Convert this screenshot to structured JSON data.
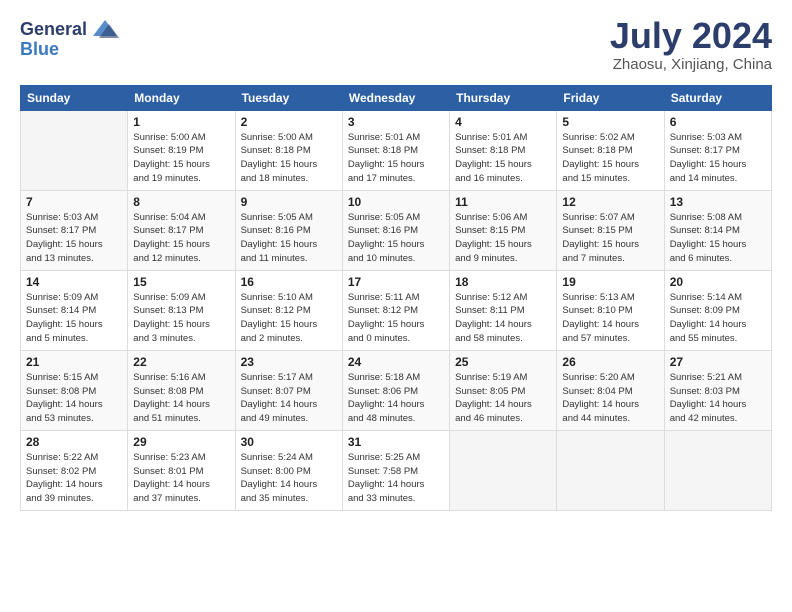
{
  "header": {
    "logo_general": "General",
    "logo_blue": "Blue",
    "month_title": "July 2024",
    "subtitle": "Zhaosu, Xinjiang, China"
  },
  "days_of_week": [
    "Sunday",
    "Monday",
    "Tuesday",
    "Wednesday",
    "Thursday",
    "Friday",
    "Saturday"
  ],
  "weeks": [
    [
      {
        "day": "",
        "info": ""
      },
      {
        "day": "1",
        "info": "Sunrise: 5:00 AM\nSunset: 8:19 PM\nDaylight: 15 hours\nand 19 minutes."
      },
      {
        "day": "2",
        "info": "Sunrise: 5:00 AM\nSunset: 8:18 PM\nDaylight: 15 hours\nand 18 minutes."
      },
      {
        "day": "3",
        "info": "Sunrise: 5:01 AM\nSunset: 8:18 PM\nDaylight: 15 hours\nand 17 minutes."
      },
      {
        "day": "4",
        "info": "Sunrise: 5:01 AM\nSunset: 8:18 PM\nDaylight: 15 hours\nand 16 minutes."
      },
      {
        "day": "5",
        "info": "Sunrise: 5:02 AM\nSunset: 8:18 PM\nDaylight: 15 hours\nand 15 minutes."
      },
      {
        "day": "6",
        "info": "Sunrise: 5:03 AM\nSunset: 8:17 PM\nDaylight: 15 hours\nand 14 minutes."
      }
    ],
    [
      {
        "day": "7",
        "info": "Sunrise: 5:03 AM\nSunset: 8:17 PM\nDaylight: 15 hours\nand 13 minutes."
      },
      {
        "day": "8",
        "info": "Sunrise: 5:04 AM\nSunset: 8:17 PM\nDaylight: 15 hours\nand 12 minutes."
      },
      {
        "day": "9",
        "info": "Sunrise: 5:05 AM\nSunset: 8:16 PM\nDaylight: 15 hours\nand 11 minutes."
      },
      {
        "day": "10",
        "info": "Sunrise: 5:05 AM\nSunset: 8:16 PM\nDaylight: 15 hours\nand 10 minutes."
      },
      {
        "day": "11",
        "info": "Sunrise: 5:06 AM\nSunset: 8:15 PM\nDaylight: 15 hours\nand 9 minutes."
      },
      {
        "day": "12",
        "info": "Sunrise: 5:07 AM\nSunset: 8:15 PM\nDaylight: 15 hours\nand 7 minutes."
      },
      {
        "day": "13",
        "info": "Sunrise: 5:08 AM\nSunset: 8:14 PM\nDaylight: 15 hours\nand 6 minutes."
      }
    ],
    [
      {
        "day": "14",
        "info": "Sunrise: 5:09 AM\nSunset: 8:14 PM\nDaylight: 15 hours\nand 5 minutes."
      },
      {
        "day": "15",
        "info": "Sunrise: 5:09 AM\nSunset: 8:13 PM\nDaylight: 15 hours\nand 3 minutes."
      },
      {
        "day": "16",
        "info": "Sunrise: 5:10 AM\nSunset: 8:12 PM\nDaylight: 15 hours\nand 2 minutes."
      },
      {
        "day": "17",
        "info": "Sunrise: 5:11 AM\nSunset: 8:12 PM\nDaylight: 15 hours\nand 0 minutes."
      },
      {
        "day": "18",
        "info": "Sunrise: 5:12 AM\nSunset: 8:11 PM\nDaylight: 14 hours\nand 58 minutes."
      },
      {
        "day": "19",
        "info": "Sunrise: 5:13 AM\nSunset: 8:10 PM\nDaylight: 14 hours\nand 57 minutes."
      },
      {
        "day": "20",
        "info": "Sunrise: 5:14 AM\nSunset: 8:09 PM\nDaylight: 14 hours\nand 55 minutes."
      }
    ],
    [
      {
        "day": "21",
        "info": "Sunrise: 5:15 AM\nSunset: 8:08 PM\nDaylight: 14 hours\nand 53 minutes."
      },
      {
        "day": "22",
        "info": "Sunrise: 5:16 AM\nSunset: 8:08 PM\nDaylight: 14 hours\nand 51 minutes."
      },
      {
        "day": "23",
        "info": "Sunrise: 5:17 AM\nSunset: 8:07 PM\nDaylight: 14 hours\nand 49 minutes."
      },
      {
        "day": "24",
        "info": "Sunrise: 5:18 AM\nSunset: 8:06 PM\nDaylight: 14 hours\nand 48 minutes."
      },
      {
        "day": "25",
        "info": "Sunrise: 5:19 AM\nSunset: 8:05 PM\nDaylight: 14 hours\nand 46 minutes."
      },
      {
        "day": "26",
        "info": "Sunrise: 5:20 AM\nSunset: 8:04 PM\nDaylight: 14 hours\nand 44 minutes."
      },
      {
        "day": "27",
        "info": "Sunrise: 5:21 AM\nSunset: 8:03 PM\nDaylight: 14 hours\nand 42 minutes."
      }
    ],
    [
      {
        "day": "28",
        "info": "Sunrise: 5:22 AM\nSunset: 8:02 PM\nDaylight: 14 hours\nand 39 minutes."
      },
      {
        "day": "29",
        "info": "Sunrise: 5:23 AM\nSunset: 8:01 PM\nDaylight: 14 hours\nand 37 minutes."
      },
      {
        "day": "30",
        "info": "Sunrise: 5:24 AM\nSunset: 8:00 PM\nDaylight: 14 hours\nand 35 minutes."
      },
      {
        "day": "31",
        "info": "Sunrise: 5:25 AM\nSunset: 7:58 PM\nDaylight: 14 hours\nand 33 minutes."
      },
      {
        "day": "",
        "info": ""
      },
      {
        "day": "",
        "info": ""
      },
      {
        "day": "",
        "info": ""
      }
    ]
  ]
}
